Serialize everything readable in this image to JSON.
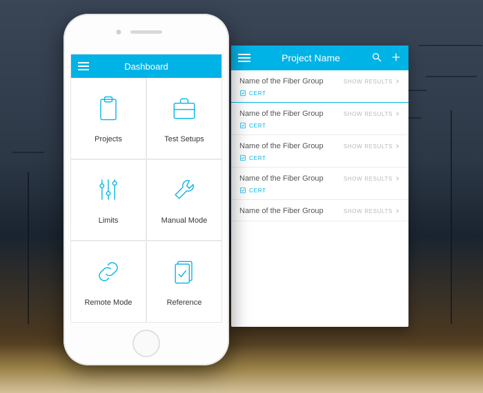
{
  "colors": {
    "accent": "#00b3e6"
  },
  "dashboard": {
    "title": "Dashboard",
    "tiles": [
      {
        "label": "Projects",
        "icon": "clipboard-icon"
      },
      {
        "label": "Test Setups",
        "icon": "briefcase-icon"
      },
      {
        "label": "Limits",
        "icon": "sliders-icon"
      },
      {
        "label": "Manual Mode",
        "icon": "wrench-icon"
      },
      {
        "label": "Remote Mode",
        "icon": "link-icon"
      },
      {
        "label": "Reference",
        "icon": "document-check-icon"
      }
    ]
  },
  "project": {
    "title": "Project Name",
    "action_label": "SHOW RESULTS",
    "cert_label": "CERT",
    "items": [
      {
        "name": "Name of the Fiber Group",
        "cert": true,
        "active": true
      },
      {
        "name": "Name of the Fiber Group",
        "cert": true,
        "active": false
      },
      {
        "name": "Name of the Fiber Group",
        "cert": true,
        "active": false
      },
      {
        "name": "Name of the Fiber Group",
        "cert": true,
        "active": false
      },
      {
        "name": "Name of the Fiber Group",
        "cert": false,
        "active": false
      }
    ]
  }
}
